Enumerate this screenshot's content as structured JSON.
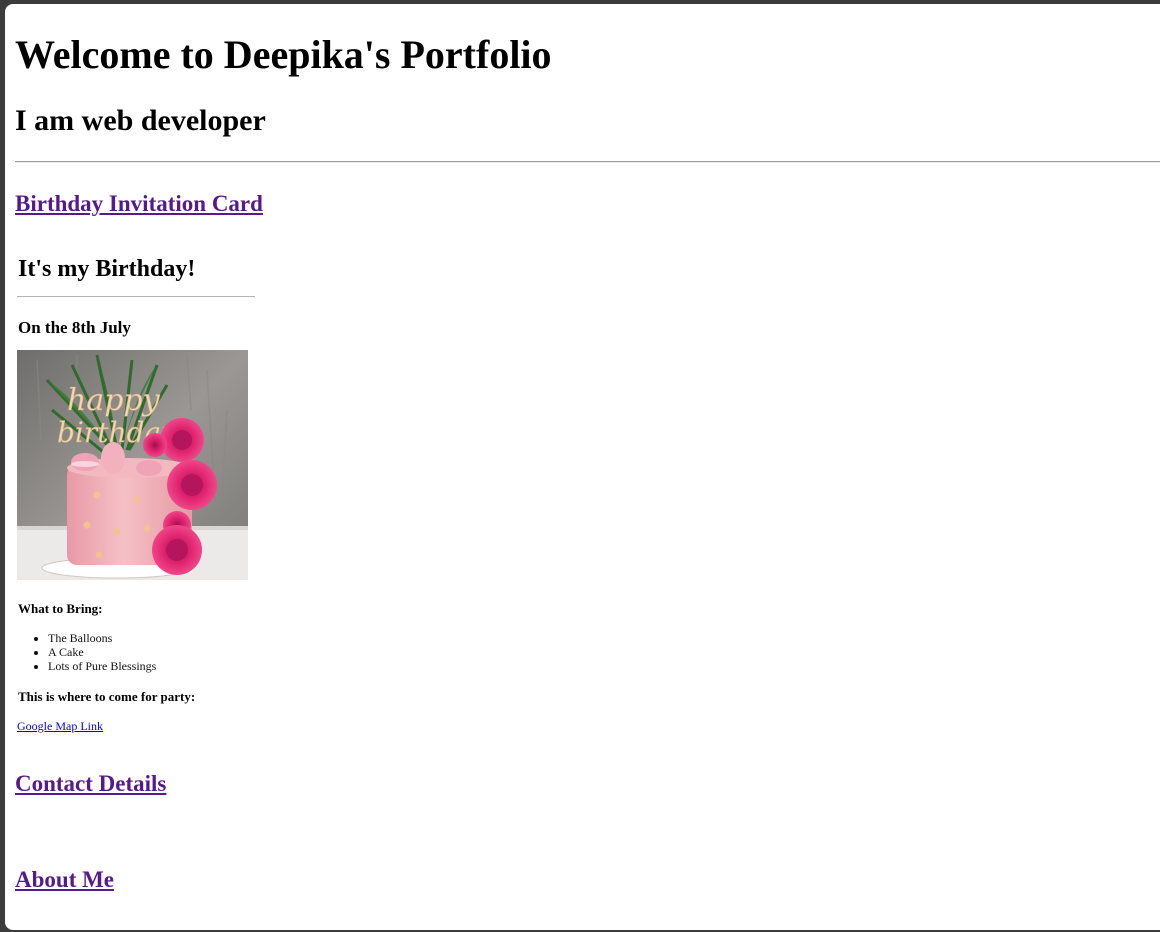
{
  "header": {
    "title": "Welcome to Deepika's Portfolio",
    "subtitle": "I am web developer"
  },
  "sections": {
    "birthday_link": "Birthday Invitation Card",
    "contact_link": "Contact Details",
    "about_link": "About Me"
  },
  "card": {
    "heading": "It's my Birthday!",
    "date": "On the 8th July",
    "cake_image": {
      "topper_text": [
        "happy",
        "birthday"
      ],
      "icon": "birthday-cake-photo"
    },
    "bring_label": "What to Bring:",
    "bring_items": [
      "The Balloons",
      "A Cake",
      "Lots of Pure Blessings"
    ],
    "party_label": "This is where to come for party:",
    "map_link": "Google Map Link"
  },
  "colors": {
    "visited_link": "#551a8b",
    "link": "#0000ee",
    "rule": "#9a9a9a"
  }
}
